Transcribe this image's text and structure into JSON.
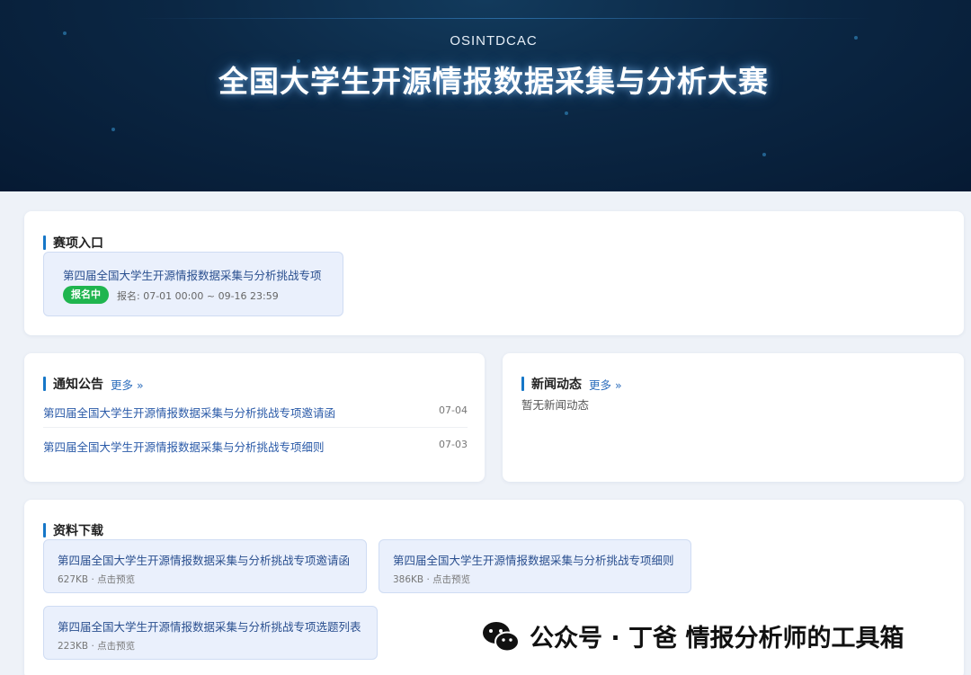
{
  "banner": {
    "subtitle": "OSINTDCAC",
    "title": "全国大学生开源情报数据采集与分析大赛"
  },
  "entry_section": {
    "title": "赛项入口",
    "item": {
      "name": "第四届全国大学生开源情报数据采集与分析挑战专项",
      "status": "报名中",
      "date": "报名: 07-01 00:00 ~ 09-16 23:59"
    }
  },
  "notices": {
    "title": "通知公告",
    "more": "更多 »",
    "items": [
      {
        "title": "第四届全国大学生开源情报数据采集与分析挑战专项邀请函",
        "date": "07-04"
      },
      {
        "title": "第四届全国大学生开源情报数据采集与分析挑战专项细则",
        "date": "07-03"
      }
    ]
  },
  "news": {
    "title": "新闻动态",
    "more": "更多 »",
    "empty": "暂无新闻动态"
  },
  "downloads": {
    "title": "资料下载",
    "files": [
      {
        "name": "第四届全国大学生开源情报数据采集与分析挑战专项邀请函",
        "meta": "627KB · 点击预览"
      },
      {
        "name": "第四届全国大学生开源情报数据采集与分析挑战专项细则",
        "meta": "386KB · 点击预览"
      },
      {
        "name": "第四届全国大学生开源情报数据采集与分析挑战专项选题列表",
        "meta": "223KB · 点击预览"
      }
    ]
  },
  "watermark": {
    "text": "公众号 · 丁爸 情报分析师的工具箱"
  },
  "colors": {
    "accent": "#1677c8",
    "badge": "#1fb54f",
    "link": "#2a5aa8"
  }
}
